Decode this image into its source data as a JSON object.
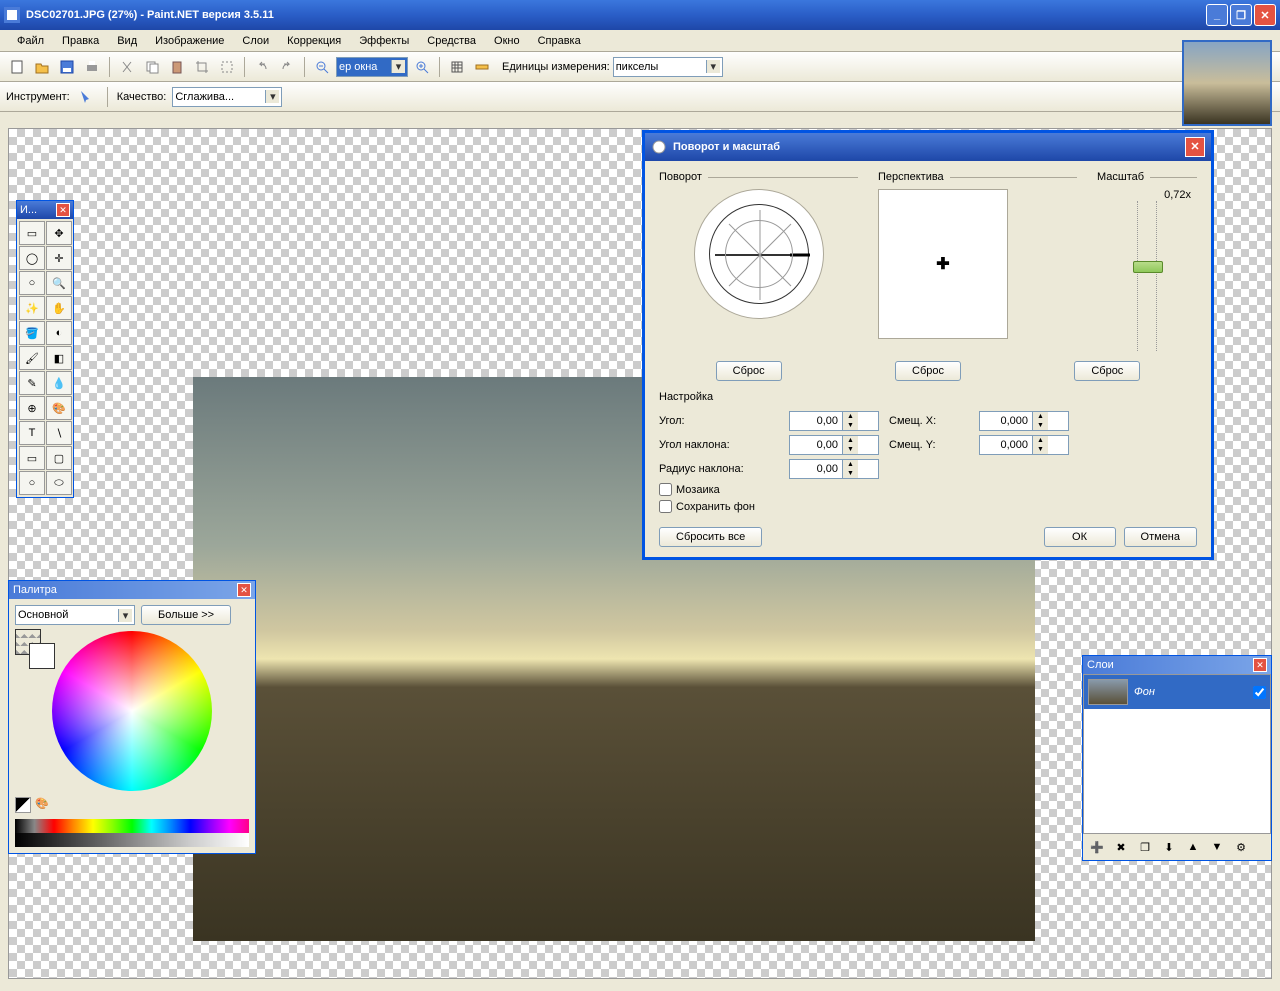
{
  "title": "DSC02701.JPG (27%) - Paint.NET версия 3.5.11",
  "menu": [
    "Файл",
    "Правка",
    "Вид",
    "Изображение",
    "Слои",
    "Коррекция",
    "Эффекты",
    "Средства",
    "Окно",
    "Справка"
  ],
  "toolbar": {
    "zoom_combo": "ер окна",
    "units_label": "Единицы измерения:",
    "units_value": "пикселы"
  },
  "toolbar2": {
    "tool_label": "Инструмент:",
    "quality_label": "Качество:",
    "quality_value": "Сглажива..."
  },
  "tools_panel": {
    "title": "И..."
  },
  "dialog": {
    "title": "Поворот и масштаб",
    "rotate_label": "Поворот",
    "perspective_label": "Перспектива",
    "scale_label": "Масштаб",
    "scale_value": "0,72x",
    "reset": "Сброс",
    "settings_label": "Настройка",
    "angle_label": "Угол:",
    "angle_value": "0,00",
    "tilt_angle_label": "Угол наклона:",
    "tilt_angle_value": "0,00",
    "tilt_radius_label": "Радиус наклона:",
    "tilt_radius_value": "0,00",
    "offset_x_label": "Смещ. X:",
    "offset_x_value": "0,000",
    "offset_y_label": "Смещ. Y:",
    "offset_y_value": "0,000",
    "mosaic_label": "Мозаика",
    "keep_bg_label": "Сохранить фон",
    "reset_all": "Сбросить все",
    "ok": "ОК",
    "cancel": "Отмена"
  },
  "palette": {
    "title": "Палитра",
    "primary": "Основной",
    "more": "Больше >>"
  },
  "layers": {
    "title": "Слои",
    "item_name": "Фон"
  }
}
